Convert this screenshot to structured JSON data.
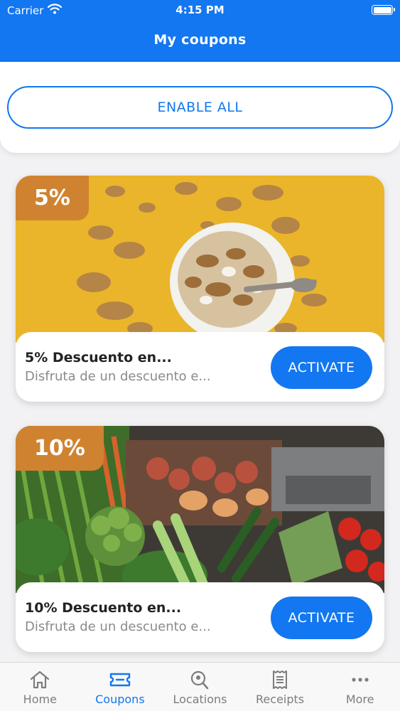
{
  "status_bar": {
    "carrier": "Carrier",
    "time": "4:15 PM"
  },
  "nav": {
    "title": "My coupons"
  },
  "enable_all": {
    "label": "ENABLE ALL"
  },
  "coupons": [
    {
      "badge": "5%",
      "title": "5% Descuento en...",
      "description": "Disfruta de un descuento e...",
      "button": "ACTIVATE",
      "image": "cereal-bowl-photo"
    },
    {
      "badge": "10%",
      "title": "10% Descuento en...",
      "description": "Disfruta de un descuento e...",
      "button": "ACTIVATE",
      "image": "vegetables-photo"
    }
  ],
  "tabs": [
    {
      "label": "Home",
      "icon": "home-icon",
      "active": false
    },
    {
      "label": "Coupons",
      "icon": "ticket-icon",
      "active": true
    },
    {
      "label": "Locations",
      "icon": "location-search-icon",
      "active": false
    },
    {
      "label": "Receipts",
      "icon": "receipt-icon",
      "active": false
    },
    {
      "label": "More",
      "icon": "more-dots-icon",
      "active": false
    }
  ],
  "colors": {
    "primary": "#1277f1",
    "badge": "#cf8331",
    "background": "#f2f2f4"
  }
}
